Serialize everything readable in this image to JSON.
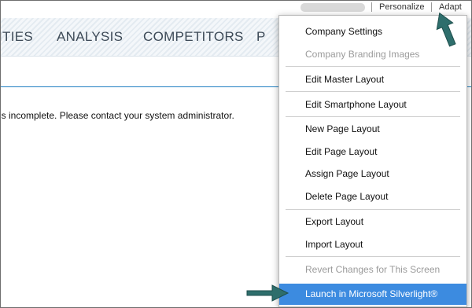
{
  "top_bar": {
    "personalize_label": "Personalize",
    "adapt_label": "Adapt"
  },
  "nav": {
    "tabs": [
      "ITIES",
      "ANALYSIS",
      "COMPETITORS",
      "P"
    ]
  },
  "content": {
    "message": "is incomplete. Please contact your system administrator."
  },
  "adapt_menu": {
    "items": [
      {
        "label": "Company Settings",
        "disabled": false
      },
      {
        "label": "Company Branding Images",
        "disabled": true
      },
      {
        "label": "Edit Master Layout",
        "disabled": false
      },
      {
        "label": "Edit Smartphone Layout",
        "disabled": false
      },
      {
        "label": "New Page Layout",
        "disabled": false
      },
      {
        "label": "Edit Page Layout",
        "disabled": false
      },
      {
        "label": "Assign Page Layout",
        "disabled": false
      },
      {
        "label": "Delete Page Layout",
        "disabled": false
      },
      {
        "label": "Export Layout",
        "disabled": false
      },
      {
        "label": "Import Layout",
        "disabled": false
      },
      {
        "label": "Revert Changes for This Screen",
        "disabled": true
      },
      {
        "label": "Launch in Microsoft Silverlight®",
        "disabled": false,
        "highlighted": true
      }
    ]
  },
  "colors": {
    "accent_line": "#1f7fc1",
    "highlight": "#3c8be0",
    "arrow": "#2e6e6c"
  },
  "icons": {
    "arrow_up": "arrow-up-icon",
    "arrow_right": "arrow-right-icon"
  }
}
